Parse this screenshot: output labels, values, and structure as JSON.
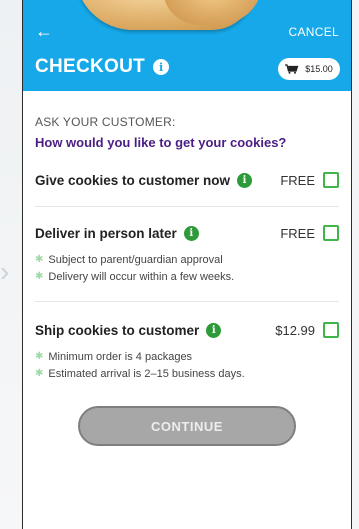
{
  "header": {
    "back_symbol": "←",
    "cancel_label": "CANCEL",
    "title": "CHECKOUT",
    "info_symbol": "i",
    "cart_total": "$15.00"
  },
  "prompt": {
    "ask": "ASK YOUR CUSTOMER:",
    "question": "How would you like to get your cookies?"
  },
  "options": [
    {
      "label": "Give cookies to customer now",
      "price": "FREE",
      "notes": []
    },
    {
      "label": "Deliver in person later",
      "price": "FREE",
      "notes": [
        "Subject to parent/guardian approval",
        "Delivery will occur within a few weeks."
      ]
    },
    {
      "label": "Ship cookies to customer",
      "price": "$12.99",
      "notes": [
        "Minimum order is 4 packages",
        "Estimated arrival is 2–15 business days."
      ]
    }
  ],
  "continue_label": "CONTINUE",
  "colors": {
    "header_blue": "#16a8e8",
    "question_purple": "#4b1e85",
    "info_green": "#2e9b3a",
    "checkbox_green": "#3fb54a",
    "button_gray": "#a7a7a7"
  }
}
